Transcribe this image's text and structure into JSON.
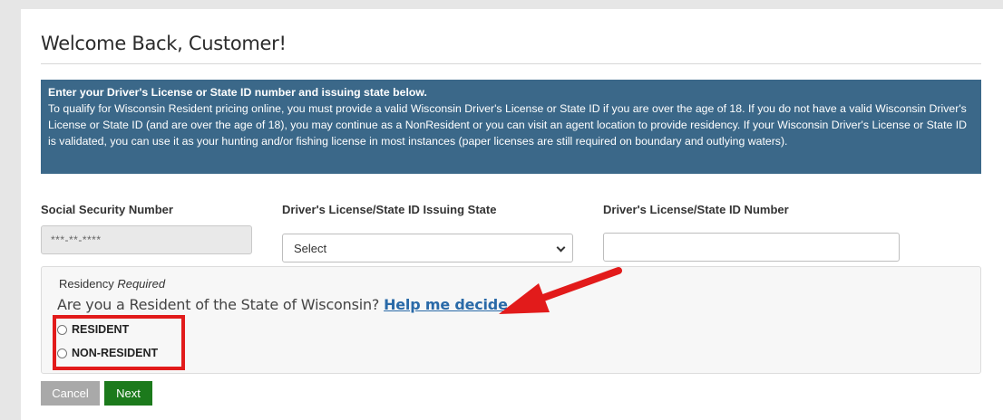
{
  "page": {
    "title": "Welcome Back, Customer!"
  },
  "info": {
    "heading": "Enter your Driver's License or State ID number and issuing state below.",
    "body": "To qualify for Wisconsin Resident pricing online, you must provide a valid Wisconsin Driver's License or State ID if you are over the age of 18.  If you do not have a valid Wisconsin Driver's License or State ID (and are over the age of 18), you may continue as a NonResident or you can visit an agent location to provide residency. If your Wisconsin Driver's License or State ID is validated, you can use it as your hunting and/or fishing license in most instances (paper licenses are still required on boundary and outlying waters)."
  },
  "fields": {
    "ssn_label": "Social Security Number",
    "ssn_value": "***-**-****",
    "state_label": "Driver's License/State ID Issuing State",
    "state_value": "Select",
    "dl_label": "Driver's License/State ID Number",
    "dl_value": ""
  },
  "residency": {
    "label": "Residency",
    "required": "Required",
    "question": "Are you a Resident of the State of Wisconsin?",
    "help_link": "Help me decide",
    "options": [
      "RESIDENT",
      "NON-RESIDENT"
    ]
  },
  "buttons": {
    "cancel": "Cancel",
    "next": "Next"
  },
  "colors": {
    "info_bg": "#3b6889",
    "next_bg": "#1c7a1c",
    "cancel_bg": "#a9a9a9",
    "annotation_red": "#e21b1b",
    "link": "#2a6aa8"
  }
}
